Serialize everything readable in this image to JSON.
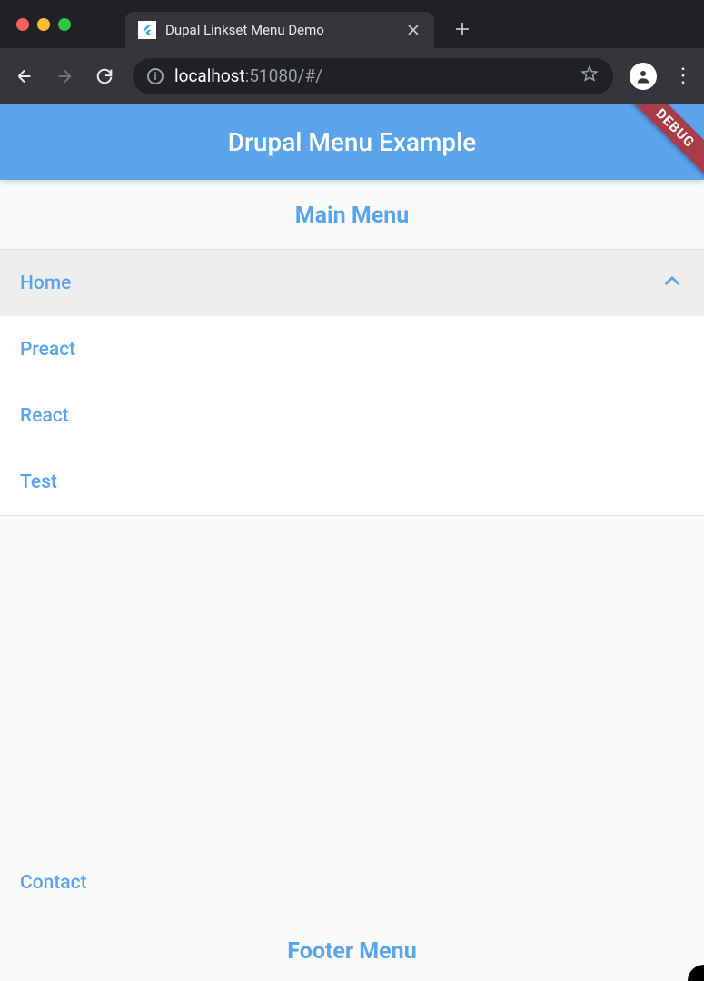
{
  "browser": {
    "tab_title": "Dupal Linkset Menu Demo",
    "url_host": "localhost",
    "url_port_path": ":51080/#/"
  },
  "app": {
    "title": "Drupal Menu Example",
    "debug_label": "DEBUG",
    "main_menu_heading": "Main Menu",
    "footer_menu_heading": "Footer Menu",
    "menu_items": {
      "home": "Home",
      "preact": "Preact",
      "react": "React",
      "test": "Test"
    },
    "footer_items": {
      "contact": "Contact"
    }
  }
}
